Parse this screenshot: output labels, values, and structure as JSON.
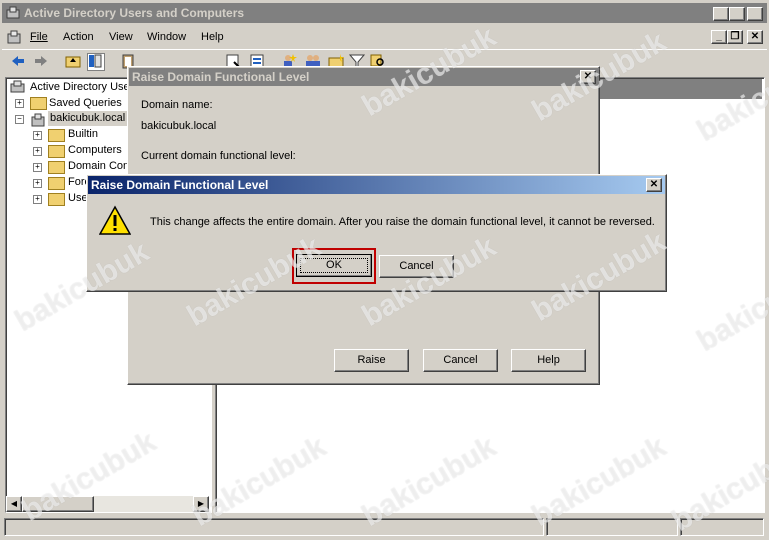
{
  "main_window": {
    "title": "Active Directory Users and Computers",
    "menu": [
      "File",
      "Action",
      "View",
      "Window",
      "Help"
    ]
  },
  "tree": {
    "root": "Active Directory Use",
    "saved_queries": "Saved Queries",
    "domain": "bakicubuk.local",
    "children": [
      "Builtin",
      "Computers",
      "Domain Cont",
      "Fore",
      "Use"
    ]
  },
  "raise_dialog": {
    "title": "Raise Domain Functional Level",
    "domain_name_label": "Domain name:",
    "domain_name_value": "bakicubuk.local",
    "current_level_label": "Current domain functional level:",
    "raise_button": "Raise",
    "cancel_button": "Cancel",
    "help_button": "Help"
  },
  "confirm_dialog": {
    "title": "Raise Domain Functional Level",
    "message": "This change affects the entire domain. After you raise the domain functional level, it cannot be reversed.",
    "ok_button": "OK",
    "cancel_button": "Cancel"
  },
  "watermark": "bakicubuk",
  "colors": {
    "highlight": "#c00000",
    "titlebar_active": "#0a246a",
    "titlebar_inactive": "#808080"
  }
}
